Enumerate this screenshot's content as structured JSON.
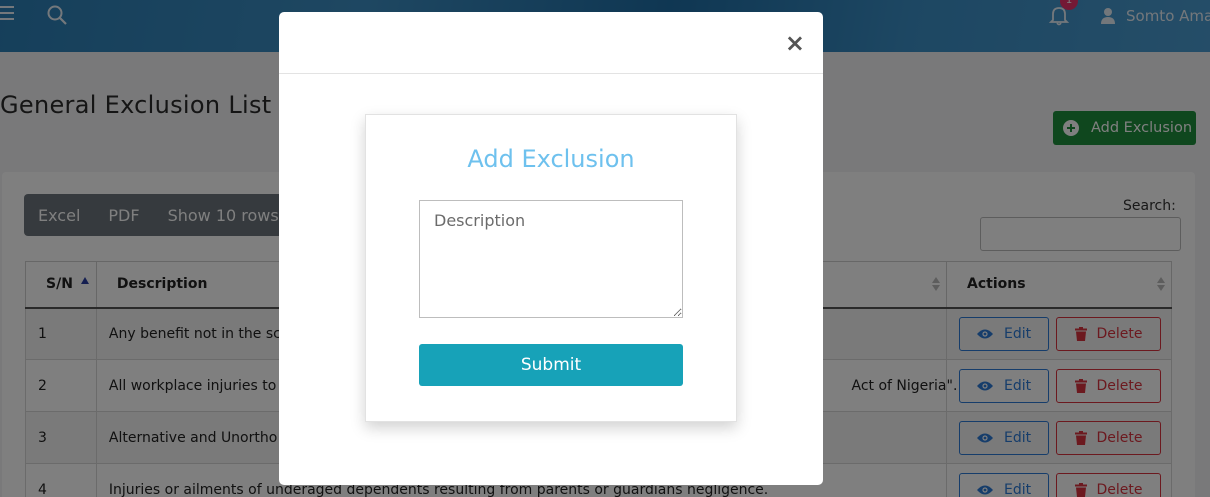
{
  "topbar": {
    "notification_count": "1",
    "user_name": "Somto Amadi"
  },
  "page": {
    "title": "General Exclusion List",
    "add_button_label": "Add Exclusion"
  },
  "table_controls": {
    "buttons": [
      "Excel",
      "PDF",
      "Show 10 rows"
    ],
    "search_label": "Search:"
  },
  "table": {
    "headers": [
      "S/N",
      "Description",
      "Actions"
    ],
    "rows": [
      {
        "sn": "1",
        "description": "Any benefit not in the sc"
      },
      {
        "sn": "2",
        "description": "All workplace injuries to",
        "description_tail": "Act of Nigeria\"."
      },
      {
        "sn": "3",
        "description": "Alternative and Unortho"
      },
      {
        "sn": "4",
        "description": "Injuries or ailments of underaged dependents resulting from parents or guardians negligence."
      }
    ],
    "edit_label": "Edit",
    "delete_label": "Delete"
  },
  "modal": {
    "close_symbol": "×",
    "form_title": "Add Exclusion",
    "description_placeholder": "Description",
    "submit_label": "Submit"
  },
  "colors": {
    "primary_blue": "#2d7ad6",
    "danger_red": "#d9333f",
    "success_green": "#1e8f3c",
    "submit_teal": "#17a2b8",
    "title_light_blue": "#6ec1ee"
  }
}
